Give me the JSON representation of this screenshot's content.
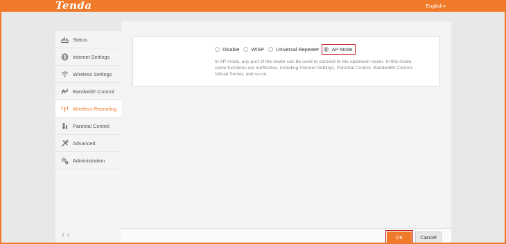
{
  "header": {
    "brand": "Tenda",
    "language": "English",
    "accent_color": "#f0792a"
  },
  "sidebar": {
    "items": [
      {
        "label": "Status",
        "icon": "status-icon"
      },
      {
        "label": "Internet Settings",
        "icon": "globe-icon"
      },
      {
        "label": "Wireless Settings",
        "icon": "wifi-icon"
      },
      {
        "label": "Bandwidth Control",
        "icon": "bandwidth-icon"
      },
      {
        "label": "Wireless Repeating",
        "icon": "repeater-icon",
        "active": true
      },
      {
        "label": "Parental Control",
        "icon": "parental-icon"
      },
      {
        "label": "Advanced",
        "icon": "tools-icon"
      },
      {
        "label": "Administration",
        "icon": "gears-icon"
      }
    ],
    "social": [
      "f",
      "t"
    ]
  },
  "repeating": {
    "modes": [
      {
        "label": "Disable"
      },
      {
        "label": "WISP"
      },
      {
        "label": "Universal Repeater"
      },
      {
        "label": "AP Mode",
        "selected": true
      }
    ],
    "description": "In AP mode, any port of the router can be used to connect to the upstream router. In this mode, some functions are ineffective, including Internet Settings, Parental Control, Bandwidth Control, Virtual Server, and so on."
  },
  "footer": {
    "ok_label": "OK",
    "cancel_label": "Cancel",
    "highlight_color": "#c0181c"
  }
}
